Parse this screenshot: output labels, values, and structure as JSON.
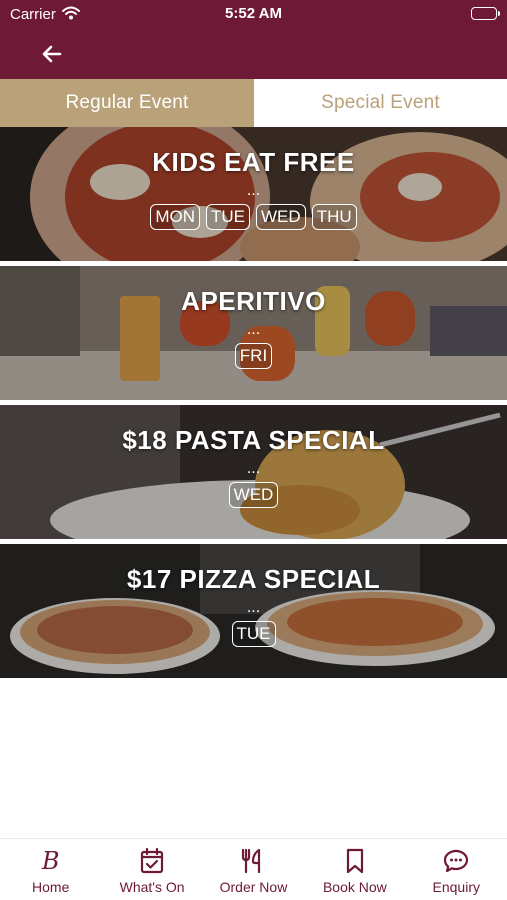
{
  "status_bar": {
    "carrier": "Carrier",
    "time": "5:52 AM"
  },
  "colors": {
    "brand": "#6e1a36",
    "gold": "#b9a179"
  },
  "tabs": [
    {
      "label": "Regular Event",
      "active": true
    },
    {
      "label": "Special Event",
      "active": false
    }
  ],
  "events": [
    {
      "title": "KIDS EAT FREE",
      "ellipsis": "...",
      "days": [
        "MON",
        "TUE",
        "WED",
        "THU"
      ]
    },
    {
      "title": "APERITIVO",
      "ellipsis": "...",
      "days": [
        "FRI"
      ]
    },
    {
      "title": "$18 PASTA SPECIAL",
      "ellipsis": "...",
      "days": [
        "WED"
      ]
    },
    {
      "title": "$17 PIZZA SPECIAL",
      "ellipsis": "...",
      "days": [
        "TUE"
      ]
    }
  ],
  "tab_bar": [
    {
      "label": "Home",
      "icon": "brand-logo-icon",
      "logo_text": "B"
    },
    {
      "label": "What's On",
      "icon": "calendar-check-icon"
    },
    {
      "label": "Order Now",
      "icon": "utensils-icon"
    },
    {
      "label": "Book Now",
      "icon": "bookmark-icon"
    },
    {
      "label": "Enquiry",
      "icon": "chat-bubble-icon"
    }
  ]
}
